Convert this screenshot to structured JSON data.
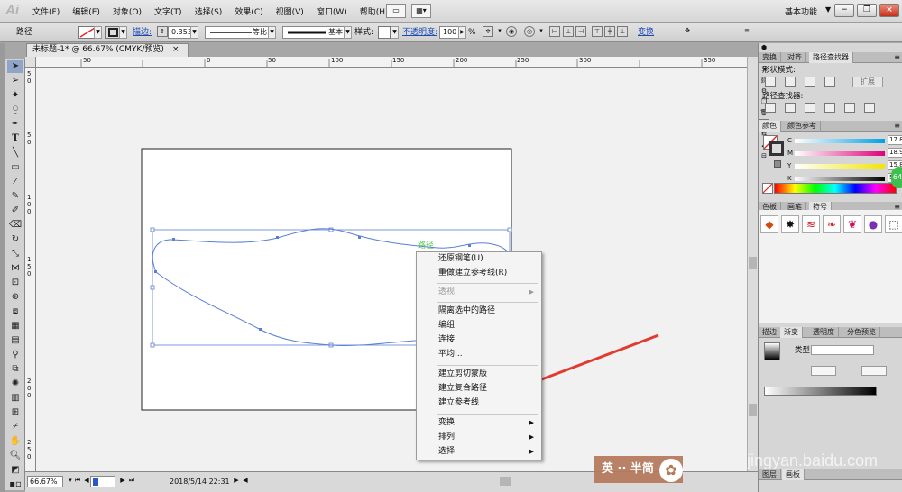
{
  "app": {
    "logo": "Ai",
    "workspace": "基本功能",
    "workspace_arrow": "▼"
  },
  "menu": [
    "文件(F)",
    "编辑(E)",
    "对象(O)",
    "文字(T)",
    "选择(S)",
    "效果(C)",
    "视图(V)",
    "窗口(W)",
    "帮助(H)"
  ],
  "control_bar": {
    "selection_label": "路径",
    "stroke_link": "描边:",
    "stroke_width": "0.353",
    "profile_label": "等比",
    "brush_label": "基本",
    "style_label": "样式:",
    "opacity_link": "不透明度:",
    "opacity_value": "100",
    "percent": "%",
    "transform_link": "变换"
  },
  "document": {
    "tab_title": "未标题-1* @ 66.67% (CMYK/预览)",
    "tab_close": "×"
  },
  "ruler": {
    "top_labels": [
      "50",
      "0",
      "50",
      "100",
      "150",
      "200",
      "250",
      "300",
      "350"
    ],
    "left_labels": [
      "5",
      "0",
      "5",
      "0",
      "1",
      "0",
      "0",
      "1",
      "5",
      "0",
      "2",
      "0",
      "0",
      "2",
      "5",
      "0"
    ]
  },
  "canvas": {
    "path_hover_label": "路径",
    "accent": "#5a7fd6",
    "annotation_arrow_color": "#e03a31"
  },
  "context_menu": {
    "items": [
      {
        "label": "还原钢笔(U)",
        "enabled": true,
        "submenu": false
      },
      {
        "label": "重做建立参考线(R)",
        "enabled": true,
        "submenu": false
      },
      {
        "label": "透视",
        "enabled": false,
        "submenu": true
      },
      {
        "label": "隔离选中的路径",
        "enabled": true,
        "submenu": false
      },
      {
        "label": "编组",
        "enabled": true,
        "submenu": false
      },
      {
        "label": "连接",
        "enabled": true,
        "submenu": false
      },
      {
        "label": "平均...",
        "enabled": true,
        "submenu": false
      },
      {
        "label": "建立剪切蒙版",
        "enabled": true,
        "submenu": false
      },
      {
        "label": "建立复合路径",
        "enabled": true,
        "submenu": false
      },
      {
        "label": "建立参考线",
        "enabled": true,
        "submenu": false
      },
      {
        "label": "变换",
        "enabled": true,
        "submenu": true
      },
      {
        "label": "排列",
        "enabled": true,
        "submenu": true
      },
      {
        "label": "选择",
        "enabled": true,
        "submenu": true
      }
    ]
  },
  "status_bar": {
    "zoom": "66.67%",
    "page": "1",
    "datetime": "2018/5/14  22:31"
  },
  "panels": {
    "transform_tabs": [
      "变换",
      "对齐",
      "路径查找器"
    ],
    "shape_modes_label": "形状模式:",
    "expand_button": "扩展",
    "pathfinder_label": "路径查找器:",
    "color_tabs": [
      "颜色",
      "颜色参考"
    ],
    "cmyk": [
      {
        "channel": "C",
        "value": "17.88"
      },
      {
        "channel": "M",
        "value": "18.99"
      },
      {
        "channel": "Y",
        "value": "15.88"
      },
      {
        "channel": "K",
        "value": "50"
      }
    ],
    "percent": "%",
    "swatch_tabs": [
      "色板",
      "画笔",
      "符号"
    ],
    "stroke_tabs": [
      "描边",
      "渐变",
      "透明度",
      "分色预览"
    ],
    "gradient_type_label": "类型:",
    "bottom_tabs": [
      "图层",
      "画板"
    ]
  },
  "watermark": {
    "text": "英 ·· 半简",
    "site": "jingyan.baidu.com",
    "badge": "64"
  }
}
